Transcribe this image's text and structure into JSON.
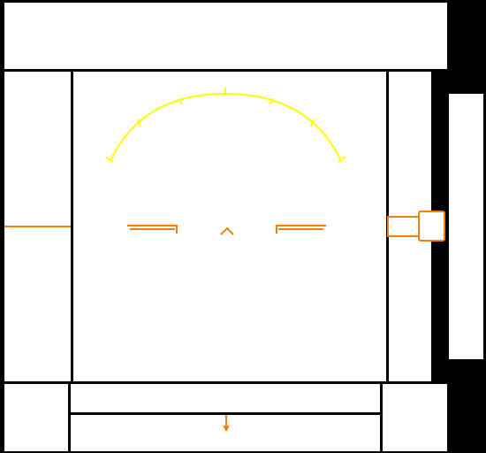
{
  "colors": {
    "background": "#000000",
    "panel": "#ffffff",
    "compass_arc": "#ffff00",
    "hud_orange": "#f08010"
  },
  "hud": {
    "compass": {
      "tick_count": 7,
      "icon": "compass-arc-icon"
    },
    "reticle": {
      "icon": "crosshair-reticle-icon"
    },
    "left_indicator": {
      "icon": "horizon-line-icon"
    },
    "right_indicator": {
      "icon": "weapon-mount-icon"
    },
    "bottom_indicator": {
      "icon": "down-arrow-icon"
    }
  }
}
